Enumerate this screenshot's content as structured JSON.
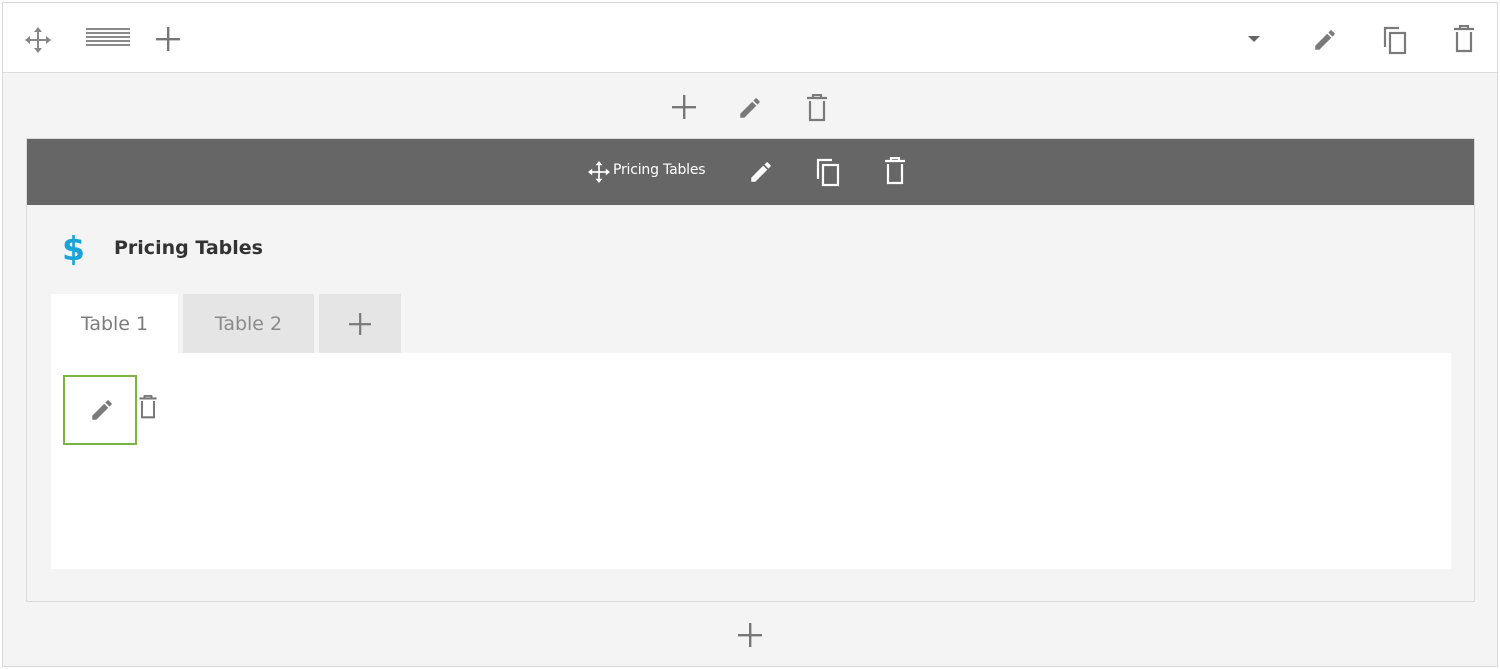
{
  "row_toolbar": {
    "icons": [
      "move-icon",
      "row-layout-icon",
      "add-icon",
      "caret-down-icon",
      "pencil-icon",
      "duplicate-icon",
      "trash-icon"
    ]
  },
  "column_controls": {
    "icons": [
      "add-icon",
      "pencil-icon",
      "trash-icon"
    ]
  },
  "module": {
    "bar_title": "Pricing Tables",
    "heading": "Pricing Tables",
    "heading_icon": "dollar-icon",
    "accent_color": "#1aa3d9",
    "tabs": [
      {
        "label": "Table 1",
        "active": true
      },
      {
        "label": "Table 2",
        "active": false
      }
    ],
    "add_tab_icon": "plus-icon",
    "edit_box_color": "#7cb342"
  },
  "bottom": {
    "icons": [
      "add-icon"
    ]
  }
}
